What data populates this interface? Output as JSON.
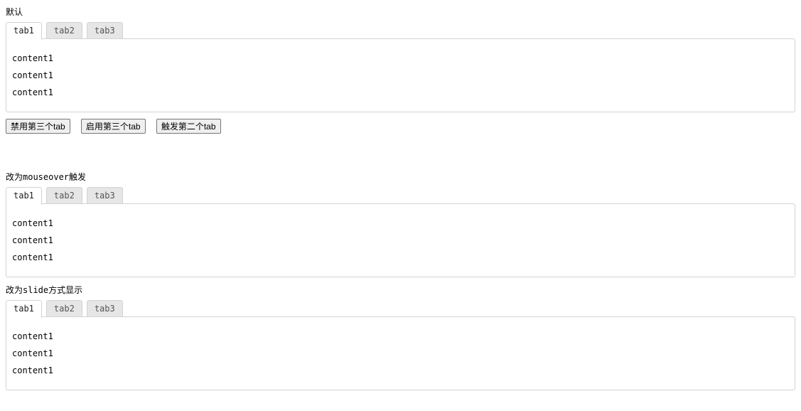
{
  "sections": [
    {
      "title": "默认",
      "tabs": [
        "tab1",
        "tab2",
        "tab3"
      ],
      "activeTab": 0,
      "content": [
        "content1",
        "content1",
        "content1"
      ],
      "buttons": [
        "禁用第三个tab",
        "启用第三个tab",
        "触发第二个tab"
      ]
    },
    {
      "title": "改为mouseover触发",
      "tabs": [
        "tab1",
        "tab2",
        "tab3"
      ],
      "activeTab": 0,
      "content": [
        "content1",
        "content1",
        "content1"
      ]
    },
    {
      "title": "改为slide方式显示",
      "tabs": [
        "tab1",
        "tab2",
        "tab3"
      ],
      "activeTab": 0,
      "content": [
        "content1",
        "content1",
        "content1"
      ]
    }
  ]
}
